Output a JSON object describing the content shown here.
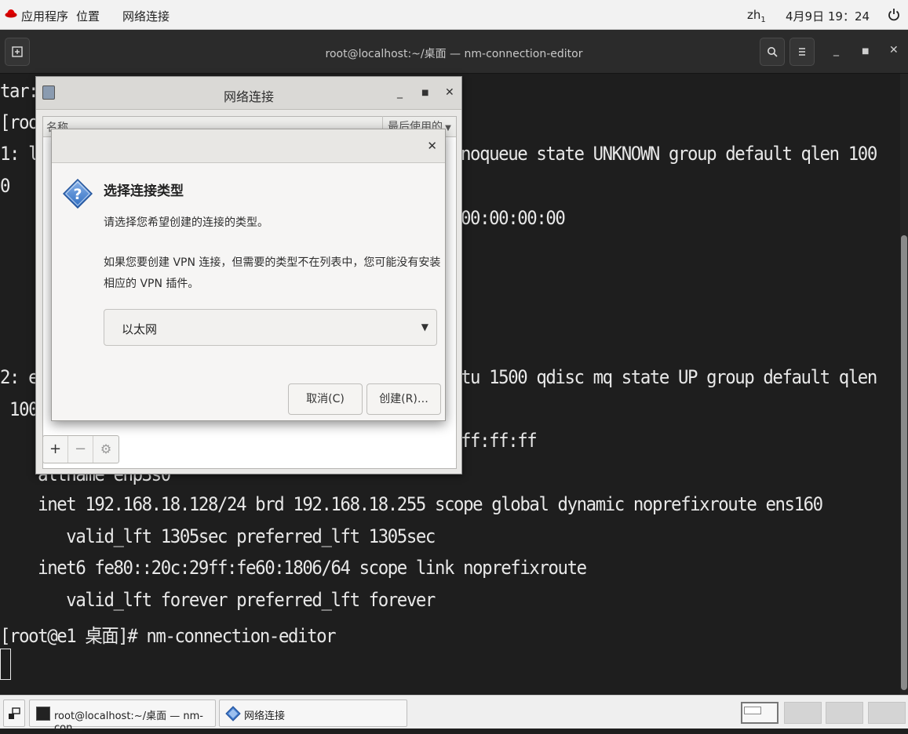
{
  "top_panel": {
    "applications": "应用程序",
    "places": "位置",
    "active_app": "网络连接",
    "input_method": "zh",
    "input_method_sub": "1",
    "datetime": "4月9日 19：24"
  },
  "terminal": {
    "title": "root@localhost:~/桌面 — nm-connection-editor",
    "lines": [
      "tar:",
      "[roo",
      "1: l",
      "0",
      "noqueue state UNKNOWN group default qlen 100",
      "00:00:00:00",
      "2: e",
      " 100",
      "tu 1500 qdisc mq state UP group default qlen",
      "ff:ff:ff",
      "    altname enp3s0",
      "    inet 192.168.18.128/24 brd 192.168.18.255 scope global dynamic noprefixroute ens160",
      "       valid_lft 1305sec preferred_lft 1305sec",
      "    inet6 fe80::20c:29ff:fe60:1806/64 scope link noprefixroute",
      "       valid_lft forever preferred_lft forever",
      "[root@e1 桌面]# nm-connection-editor"
    ]
  },
  "nm_window": {
    "title": "网络连接",
    "col_name": "名称",
    "col_last_used": "最后使用的"
  },
  "dialog": {
    "heading": "选择连接类型",
    "text1": "请选择您希望创建的连接的类型。",
    "text2": "如果您要创建 VPN 连接，但需要的类型不在列表中，您可能没有安装相应的 VPN 插件。",
    "combo_value": "以太网",
    "cancel_label": "取消(C)",
    "create_label": "创建(R)…"
  },
  "taskbar": {
    "item1": "root@localhost:~/桌面 — nm-con…",
    "item2": "网络连接"
  }
}
